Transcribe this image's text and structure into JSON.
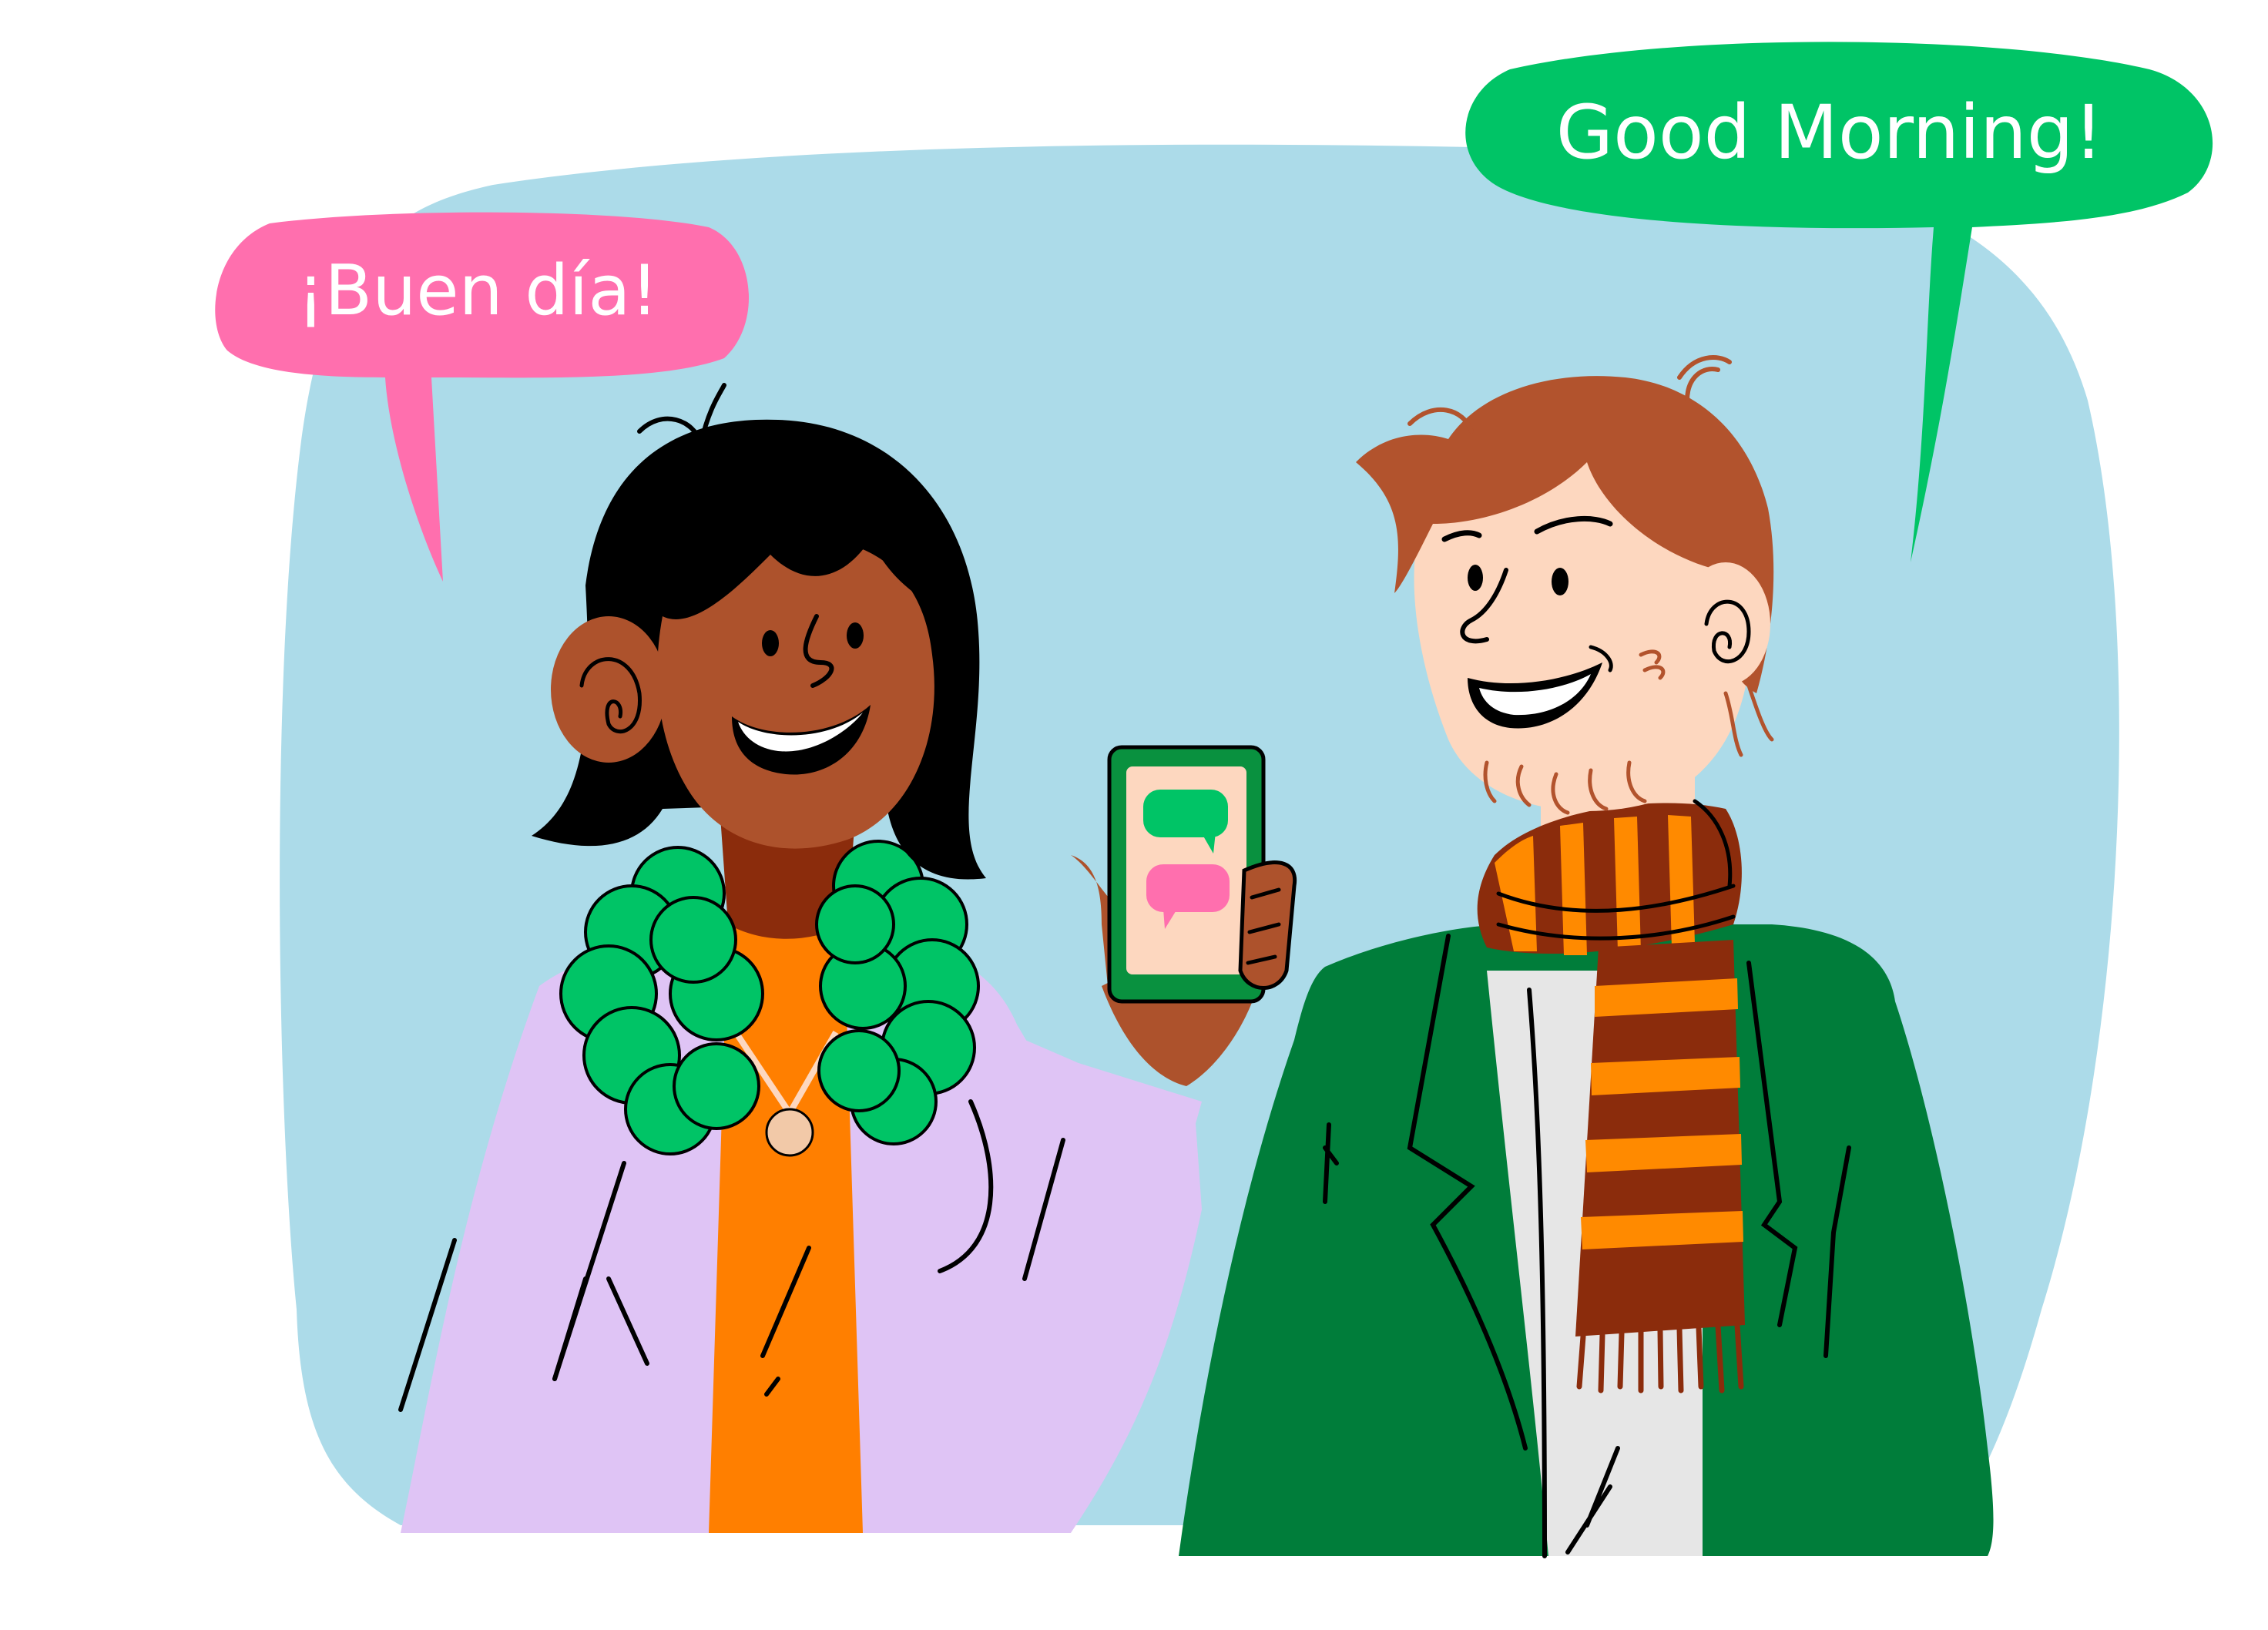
{
  "bubbles": {
    "left": {
      "text": "¡Buen día!",
      "color": "#ff6fae"
    },
    "right": {
      "text": "Good Morning!",
      "color": "#00c466"
    }
  },
  "colors": {
    "backdrop": "#acdbe9",
    "woman_skin": "#ad522c",
    "woman_hair": "#000000",
    "woman_jacket": "#dfc4f5",
    "woman_top": "#ff7f00",
    "woman_collar": "#00c466",
    "man_skin": "#fdd7bf",
    "man_hair": "#b2532d",
    "man_jacket": "#007d3a",
    "man_shirt": "#e6e6e6",
    "scarf_dark": "#8b2c0c",
    "scarf_light": "#ff8a00",
    "phone_frame": "#09913f",
    "phone_screen": "#fdd7bf"
  },
  "phone": {
    "message_icons": [
      "green-chat-bubble-icon",
      "pink-chat-bubble-icon"
    ]
  }
}
